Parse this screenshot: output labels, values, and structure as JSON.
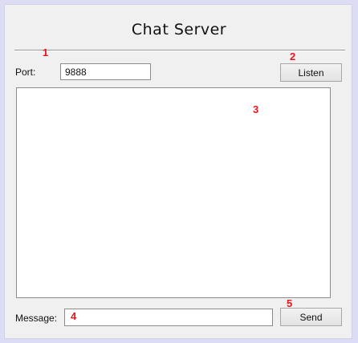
{
  "window": {
    "title": "Chat Server"
  },
  "port": {
    "label": "Port:",
    "value": "9888"
  },
  "listen_button": {
    "label": "Listen"
  },
  "message": {
    "label": "Message:",
    "value": ""
  },
  "send_button": {
    "label": "Send"
  },
  "markers": [
    "1",
    "2",
    "3",
    "4",
    "5"
  ],
  "colors": {
    "marker": "#e8141e",
    "window_bg": "#f0f0f0",
    "frame": "#dcdcf4"
  }
}
